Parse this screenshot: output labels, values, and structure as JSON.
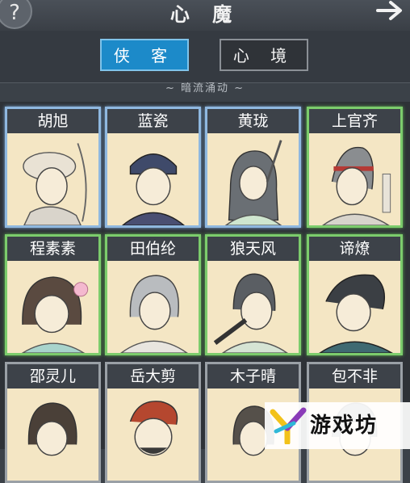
{
  "header": {
    "title": "心 魔",
    "help_label": "?",
    "help_icon": "question-mark-icon",
    "forward_icon": "arrow-right-icon"
  },
  "tabs": [
    {
      "label": "侠 客",
      "active": true
    },
    {
      "label": "心 境",
      "active": false
    }
  ],
  "section_label": "~ 暗流涌动 ~",
  "characters": [
    {
      "name": "胡旭",
      "frame": "blue"
    },
    {
      "name": "蓝瓷",
      "frame": "blue"
    },
    {
      "name": "黄珑",
      "frame": "blue"
    },
    {
      "name": "上官齐",
      "frame": "green"
    },
    {
      "name": "程素素",
      "frame": "green"
    },
    {
      "name": "田伯纶",
      "frame": "green"
    },
    {
      "name": "狼天风",
      "frame": "green"
    },
    {
      "name": "谛燎",
      "frame": "green"
    },
    {
      "name": "邵灵儿",
      "frame": "plain"
    },
    {
      "name": "岳大剪",
      "frame": "plain"
    },
    {
      "name": "木子晴",
      "frame": "plain"
    },
    {
      "name": "包不非",
      "frame": "plain"
    }
  ],
  "watermark": {
    "text": "游戏坊",
    "icon": "y-logo-icon"
  },
  "colors": {
    "active_tab": "#1c8ac9",
    "blue_frame": "#8fb8e0",
    "green_frame": "#7ccc6c",
    "card_bg": "#f4e6c4"
  }
}
